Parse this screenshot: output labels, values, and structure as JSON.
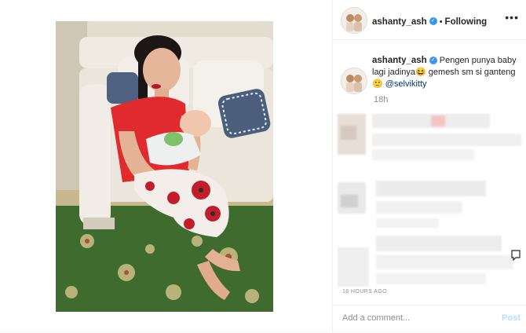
{
  "post": {
    "username": "ashanty_ash",
    "follow_label": "Following",
    "more_label": "•••",
    "caption_line1": "Pengen punya baby",
    "caption_line2": "lagi jadinya😆 gemesh sm si ganteng",
    "caption_emoji": "🙂",
    "mention": "@selvikitty",
    "caption_time": "18h",
    "timestamp": "18 HOURS AGO",
    "comment_placeholder": "Add a comment...",
    "post_label": "Post"
  },
  "colors": {
    "verified": "#3897f0",
    "mention": "#003569",
    "post_disabled": "#b2dffc",
    "shirt": "#e02a2f",
    "carpet": "#3f6b2e"
  }
}
